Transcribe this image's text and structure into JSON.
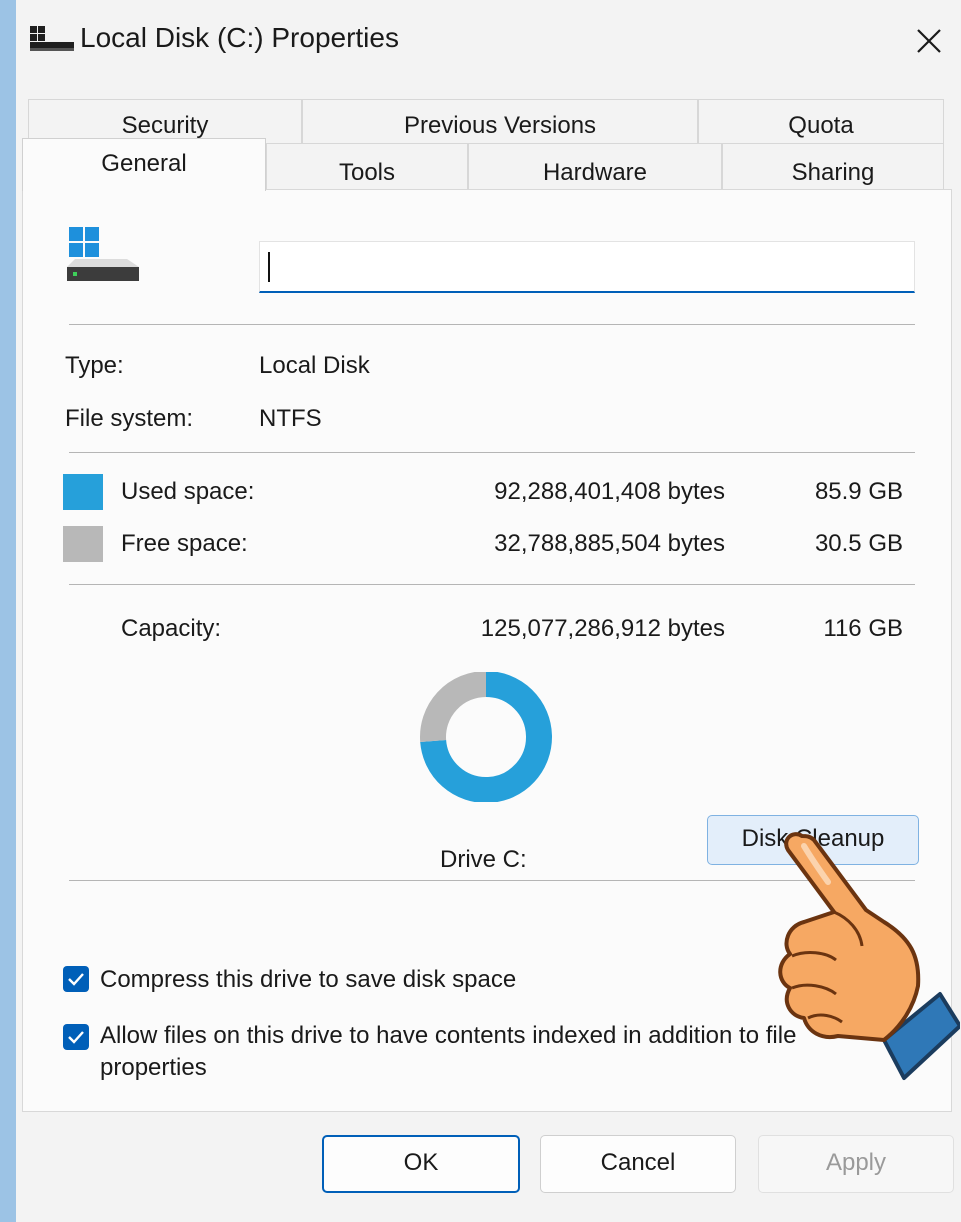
{
  "window": {
    "title": "Local Disk (C:) Properties"
  },
  "tabs": {
    "row1": [
      "Security",
      "Previous Versions",
      "Quota"
    ],
    "row2": [
      "General",
      "Tools",
      "Hardware",
      "Sharing"
    ],
    "active": "General"
  },
  "general": {
    "name_value": "",
    "type_label": "Type:",
    "type_value": "Local Disk",
    "fs_label": "File system:",
    "fs_value": "NTFS",
    "used_label": "Used space:",
    "used_bytes": "92,288,401,408 bytes",
    "used_gb": "85.9 GB",
    "free_label": "Free space:",
    "free_bytes": "32,788,885,504 bytes",
    "free_gb": "30.5 GB",
    "capacity_label": "Capacity:",
    "capacity_bytes": "125,077,286,912 bytes",
    "capacity_gb": "116 GB",
    "drive_label": "Drive C:",
    "cleanup_label": "Disk Cleanup",
    "compress_label": "Compress this drive to save disk space",
    "index_label_line1": "Allow files on this drive to have contents indexed in addition to file",
    "index_label_line2": "properties",
    "compress_checked": true,
    "index_checked": true
  },
  "chart_data": {
    "type": "pie",
    "categories": [
      "Used space",
      "Free space"
    ],
    "values": [
      92288401408,
      32788885504
    ],
    "colors": [
      "#26a0da",
      "#b8b8b8"
    ],
    "donut": true
  },
  "buttons": {
    "ok": "OK",
    "cancel": "Cancel",
    "apply": "Apply"
  },
  "icons": {
    "title": "drive-icon",
    "close": "close-icon",
    "drive": "drive-icon",
    "pointer": "pointing-hand-icon"
  }
}
